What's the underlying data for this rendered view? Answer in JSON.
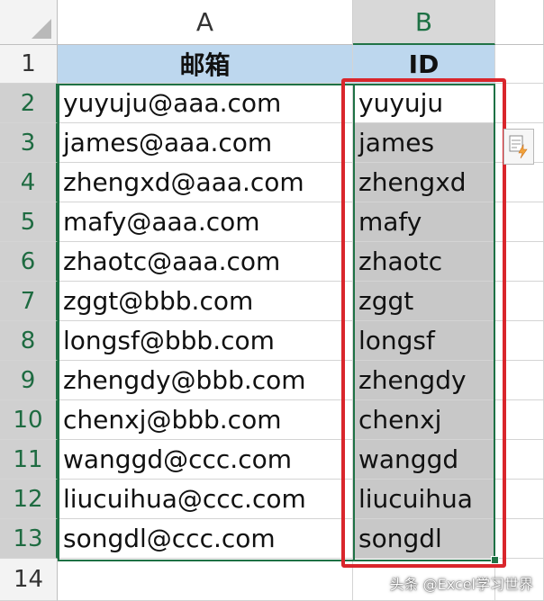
{
  "columns": [
    "A",
    "B"
  ],
  "headers": {
    "email": "邮箱",
    "id": "ID"
  },
  "rows": [
    {
      "num": "2",
      "email": "yuyuju@aaa.com",
      "id": "yuyuju"
    },
    {
      "num": "3",
      "email": "james@aaa.com",
      "id": "james"
    },
    {
      "num": "4",
      "email": "zhengxd@aaa.com",
      "id": "zhengxd"
    },
    {
      "num": "5",
      "email": "mafy@aaa.com",
      "id": "mafy"
    },
    {
      "num": "6",
      "email": "zhaotc@aaa.com",
      "id": "zhaotc"
    },
    {
      "num": "7",
      "email": "zggt@bbb.com",
      "id": "zggt"
    },
    {
      "num": "8",
      "email": "longsf@bbb.com",
      "id": "longsf"
    },
    {
      "num": "9",
      "email": "zhengdy@bbb.com",
      "id": "zhengdy"
    },
    {
      "num": "10",
      "email": "chenxj@bbb.com",
      "id": "chenxj"
    },
    {
      "num": "11",
      "email": "wanggd@ccc.com",
      "id": "wanggd"
    },
    {
      "num": "12",
      "email": "liucuihua@ccc.com",
      "id": "liucuihua"
    },
    {
      "num": "13",
      "email": "songdl@ccc.com",
      "id": "songdl"
    }
  ],
  "row_header_1": "1",
  "row_header_14": "14",
  "watermark": "头条 @Excel学习世界",
  "colors": {
    "header_fill": "#bdd7ee",
    "selection_fill": "#c8c8c8",
    "highlight_frame": "#d9262c",
    "excel_green": "#217346"
  },
  "icons": {
    "flash_fill": "flash-fill-options-icon"
  }
}
